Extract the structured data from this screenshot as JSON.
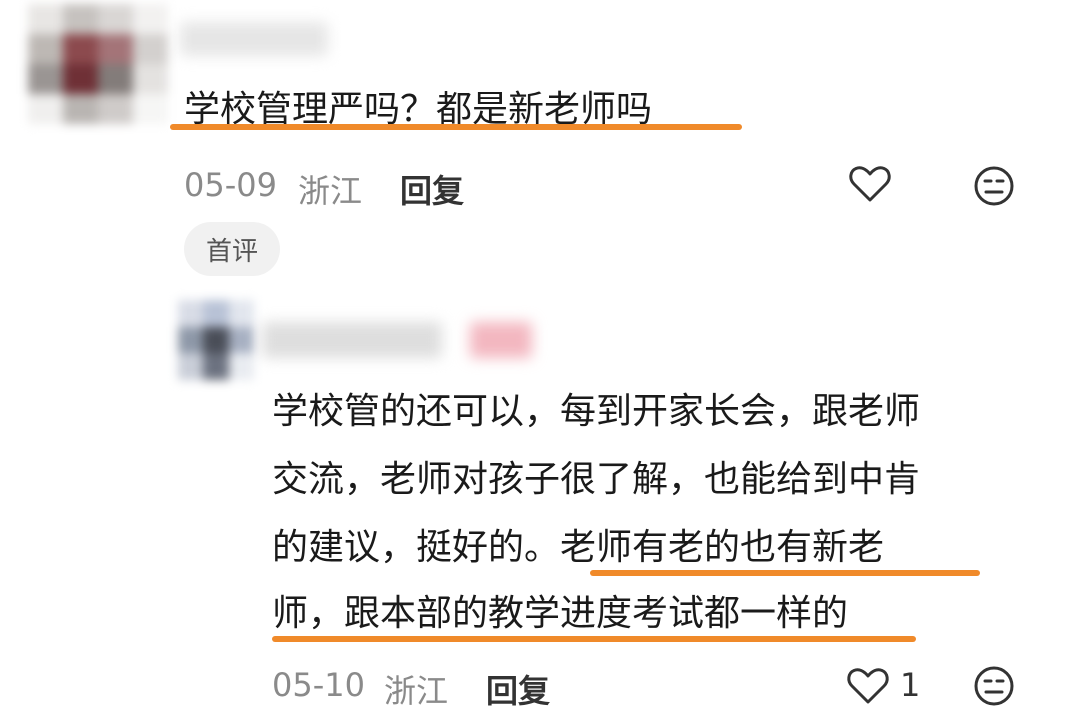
{
  "comments": [
    {
      "username": "",
      "text": "学校管理严吗？都是新老师吗",
      "date": "05-09",
      "location": "浙江",
      "reply_label": "回复",
      "badge": "首评",
      "like_count": ""
    },
    {
      "username": "",
      "text_lines": [
        "学校管的还可以，每到开家长会，跟老师",
        "交流，老师对孩子很了解，也能给到中肯",
        "的建议，挺好的。老师有老的也有新老",
        "师，跟本部的教学进度考试都一样的"
      ],
      "date": "05-10",
      "location": "浙江",
      "reply_label": "回复",
      "like_count": "1"
    }
  ],
  "icons": {
    "like": "heart-outline-icon",
    "dislike": "neutral-face-icon"
  },
  "colors": {
    "highlight": "#f08a2a",
    "meta_text": "#8a8a8a",
    "body_text": "#1a1a1a",
    "badge_bg": "#f1f1f1"
  }
}
